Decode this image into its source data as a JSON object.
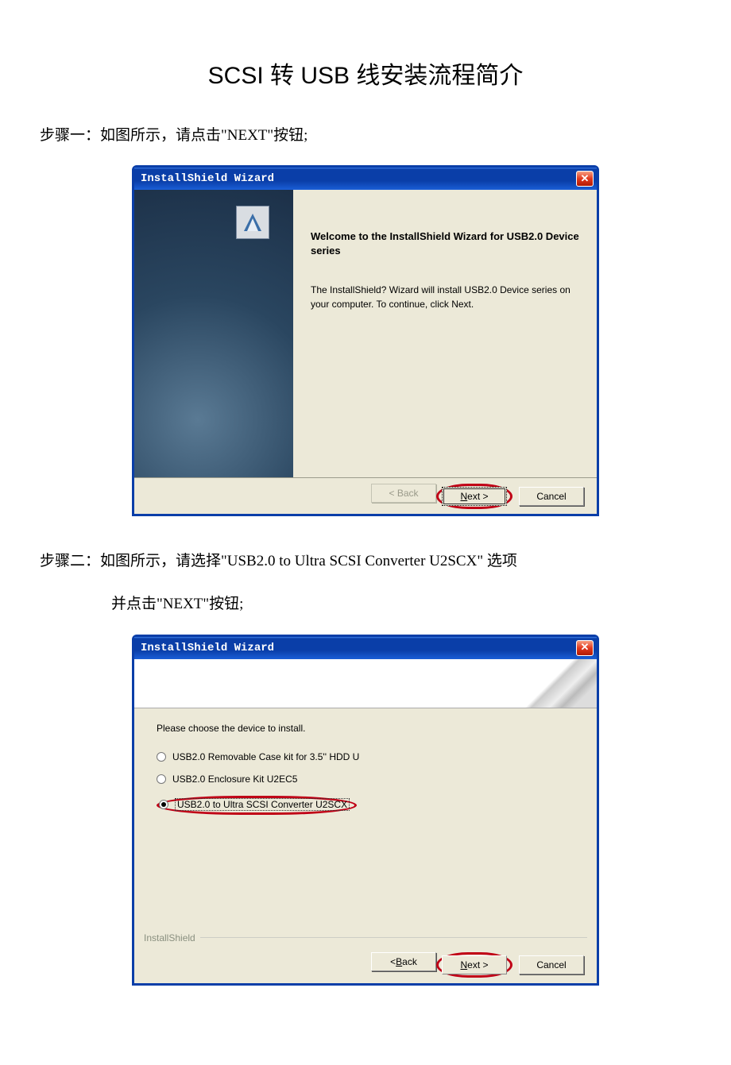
{
  "doc": {
    "title": "SCSI 转 USB 线安装流程简介",
    "step1": "步骤一：如图所示，请点击\"NEXT\"按钮;",
    "step2_line1": "步骤二：如图所示，请选择\"USB2.0 to Ultra SCSI Converter U2SCX\"  选项",
    "step2_line2": "并点击\"NEXT\"按钮;"
  },
  "wizard1": {
    "title": "InstallShield Wizard",
    "heading": "Welcome to the InstallShield Wizard for USB2.0 Device series",
    "desc": "The InstallShield? Wizard will install USB2.0 Device series on your computer.  To continue, click Next.",
    "buttons": {
      "back": "< Back",
      "next_u": "N",
      "next_rest": "ext >",
      "cancel": "Cancel"
    }
  },
  "wizard2": {
    "title": "InstallShield Wizard",
    "prompt": "Please choose the device to install.",
    "options": [
      {
        "label": "USB2.0 Removable Case kit for 3.5'' HDD U",
        "selected": false
      },
      {
        "label": "USB2.0 Enclosure Kit U2EC5",
        "selected": false
      },
      {
        "label": "USB2.0 to Ultra SCSI Converter U2SCX",
        "selected": true
      }
    ],
    "footer_label": "InstallShield",
    "buttons": {
      "back_u": "B",
      "back_prefix": "< ",
      "back_rest": "ack",
      "next_u": "N",
      "next_rest": "ext >",
      "cancel": "Cancel"
    }
  }
}
